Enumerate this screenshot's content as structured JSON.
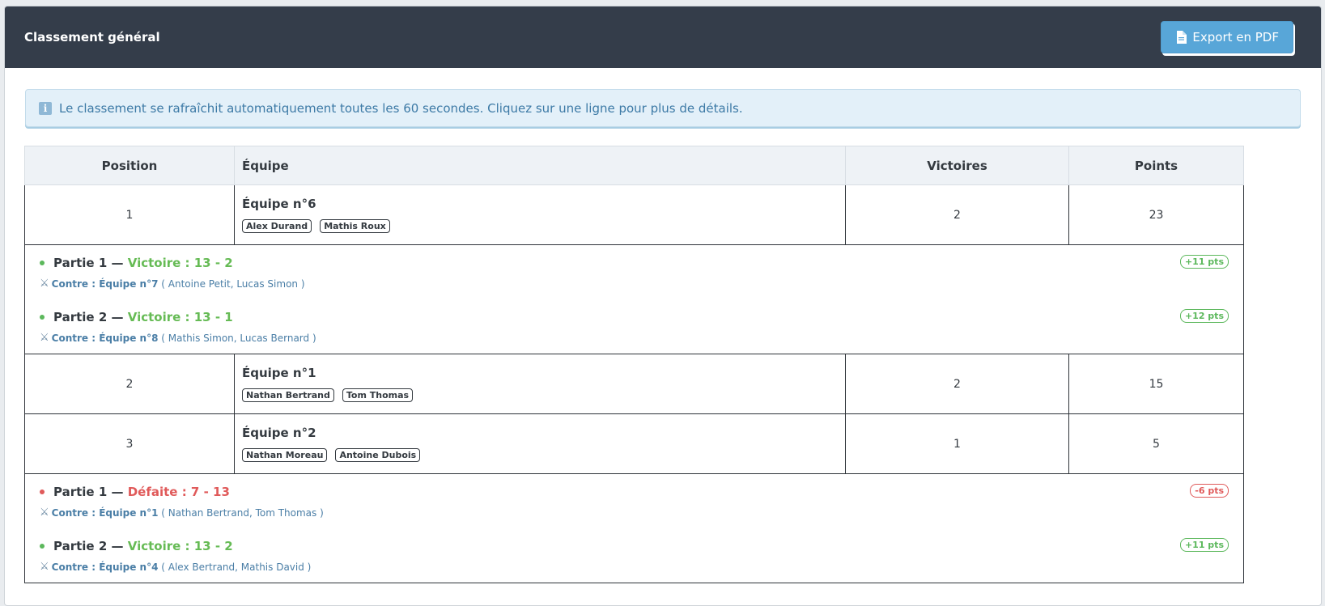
{
  "header": {
    "title": "Classement général",
    "export_label": "Export en PDF",
    "export_icon": "file-icon"
  },
  "info": {
    "icon": "info-icon",
    "text": "Le classement se rafraîchit automatiquement toutes les 60 secondes. Cliquez sur une ligne pour plus de détails."
  },
  "table": {
    "headers": {
      "position": "Position",
      "team": "Équipe",
      "wins": "Victoires",
      "points": "Points"
    },
    "rows": [
      {
        "position": "1",
        "team": "Équipe n°6",
        "players": [
          "Alex Durand",
          "Mathis Roux"
        ],
        "wins": "2",
        "points": "23",
        "matches": [
          {
            "title": "Partie 1",
            "sep": " — ",
            "result": "Victoire : 13 - 2",
            "outcome": "win",
            "vs": "Contre : Équipe n°7",
            "members": " ( Antoine Petit, Lucas Simon )",
            "pts": "+11 pts"
          },
          {
            "title": "Partie 2",
            "sep": " — ",
            "result": "Victoire : 13 - 1",
            "outcome": "win",
            "vs": "Contre : Équipe n°8",
            "members": " ( Mathis Simon, Lucas Bernard )",
            "pts": "+12 pts"
          }
        ]
      },
      {
        "position": "2",
        "team": "Équipe n°1",
        "players": [
          "Nathan Bertrand",
          "Tom Thomas"
        ],
        "wins": "2",
        "points": "15",
        "matches": []
      },
      {
        "position": "3",
        "team": "Équipe n°2",
        "players": [
          "Nathan Moreau",
          "Antoine Dubois"
        ],
        "wins": "1",
        "points": "5",
        "matches": [
          {
            "title": "Partie 1",
            "sep": " — ",
            "result": "Défaite : 7 - 13",
            "outcome": "loss",
            "vs": "Contre : Équipe n°1",
            "members": " ( Nathan Bertrand, Tom Thomas )",
            "pts": "-6 pts"
          },
          {
            "title": "Partie 2",
            "sep": " — ",
            "result": "Victoire : 13 - 2",
            "outcome": "win",
            "vs": "Contre : Équipe n°4",
            "members": " ( Alex Bertrand, Mathis David )",
            "pts": "+11 pts"
          }
        ]
      }
    ]
  },
  "colors": {
    "header_bg": "#343d4a",
    "accent": "#58a6d8",
    "win": "#5cb85c",
    "loss": "#e05a5a"
  }
}
